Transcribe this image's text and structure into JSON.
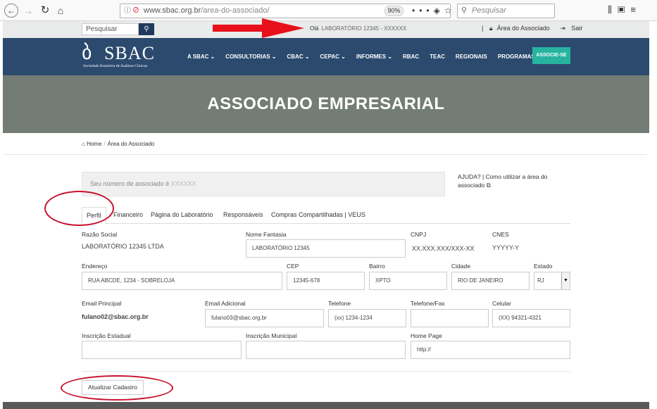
{
  "browser": {
    "url_domain": "www.sbac.org.br",
    "url_path": "/area-do-associado/",
    "zoom": "90%",
    "search_placeholder": "Pesquisar"
  },
  "utility": {
    "search_placeholder": "Pesquisar",
    "greeting": "Olá",
    "user": "LABORATÓRIO 12345 - XXXXXX",
    "area_link": "Área do Associado",
    "logout": "Sair"
  },
  "logo": {
    "name": "SBAC",
    "subtitle": "Sociedade Brasileira de Análises Clínicas"
  },
  "nav": {
    "items": [
      "A SBAC ⌄",
      "CONSULTORIAS ⌄",
      "CBAC ⌄",
      "CEPAC ⌄",
      "INFORMES ⌄",
      "RBAC",
      "TEAC",
      "REGIONAIS",
      "PROGRAMAS ⌄"
    ],
    "cta": "ASSOCIE-SE"
  },
  "banner": {
    "title": "ASSOCIADO EMPRESARIAL"
  },
  "breadcrumb": {
    "home": "Home",
    "current": "Área do Associado"
  },
  "member": {
    "label": "Seu número de associado é",
    "number": "XXXXXX"
  },
  "help": {
    "text": "AJUDA? | Como utilizar a área do associado"
  },
  "tabs": [
    "Perfil",
    "Financeiro",
    "Página do Laboratório",
    "Responsáveis",
    "Compras Compartilhadas | VEUS"
  ],
  "form": {
    "razao_social": {
      "label": "Razão Social",
      "value": "LABORATÓRIO 12345 LTDA"
    },
    "nome_fantasia": {
      "label": "Nome Fantasia",
      "value": "LABORATÓRIO 12345"
    },
    "cnpj": {
      "label": "CNPJ",
      "value": "XX.XXX.XXX/XXX-XX"
    },
    "cnes": {
      "label": "CNES",
      "value": "YYYYY-Y"
    },
    "endereco": {
      "label": "Endereço",
      "value": "RUA ABCDE, 1234 - SOBRELOJA"
    },
    "cep": {
      "label": "CEP",
      "value": "12345-678"
    },
    "bairro": {
      "label": "Bairro",
      "value": "XPTO"
    },
    "cidade": {
      "label": "Cidade",
      "value": "RIO DE JANEIRO"
    },
    "estado": {
      "label": "Estado",
      "value": "RJ"
    },
    "email_principal": {
      "label": "Email Principal",
      "value": "fulano02@sbac.org.br"
    },
    "email_adicional": {
      "label": "Email Adicional",
      "value": "fulano03@sbac.org.br"
    },
    "telefone": {
      "label": "Telefone",
      "value": "(xx) 1234-1234"
    },
    "telefone_fax": {
      "label": "Telefone/Fax",
      "value": ""
    },
    "celular": {
      "label": "Celular",
      "value": "(XX) 94321-4321"
    },
    "inscricao_estadual": {
      "label": "Inscrição Estadual",
      "value": ""
    },
    "inscricao_municipal": {
      "label": "Inscrição Municipal",
      "value": ""
    },
    "home_page": {
      "label": "Home Page",
      "value": "http://"
    },
    "submit": "Atualizar Cadastro"
  },
  "colors": {
    "nav": "#2b4a6e",
    "banner": "#747d75",
    "cta": "#27b3a0",
    "annotation": "#c8102e"
  }
}
